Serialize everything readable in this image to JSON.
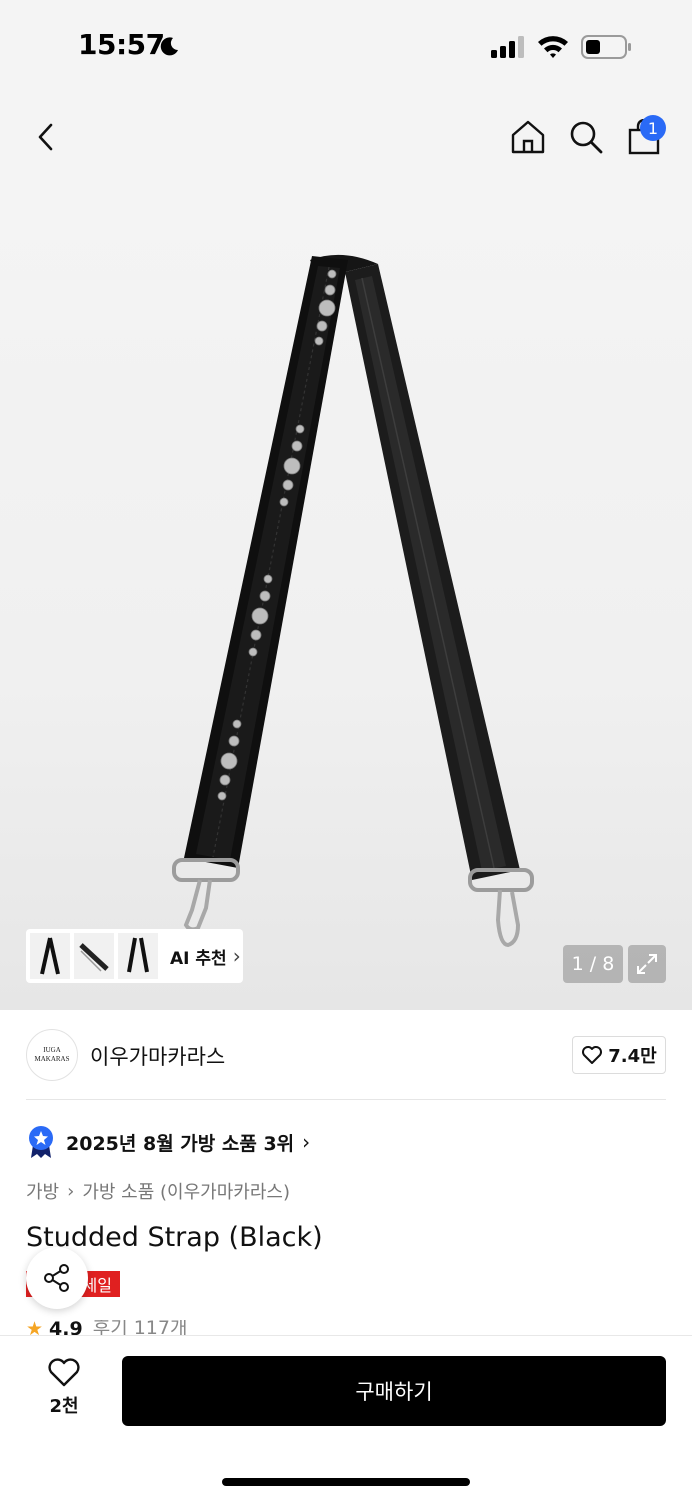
{
  "status_bar": {
    "time": "15:57"
  },
  "nav": {
    "cart_count": "1"
  },
  "gallery": {
    "ai_label": "AI 추천",
    "page_counter": "1 / 8"
  },
  "brand": {
    "logo_line1": "IUGA",
    "logo_line2": "MAKARAS",
    "name": "이우가마카라스",
    "likes": "7.4만"
  },
  "ranking": {
    "text": "2025년 8월 가방 소품 3위"
  },
  "breadcrumb": {
    "level1": "가방",
    "level2": "가방 소품 (이우가마카라스)"
  },
  "product": {
    "title": "Studded Strap (Black)",
    "sale_badge": "세일",
    "rating": "4.9",
    "reviews": "후기 117개"
  },
  "bottom_bar": {
    "wish_count": "2천",
    "buy_label": "구매하기"
  },
  "colors": {
    "accent_blue": "#2a6af6",
    "sale_red": "#e02020",
    "star": "#f5a524",
    "buy_button": "#000000"
  },
  "icons": [
    "moon-icon",
    "signal-icon",
    "wifi-icon",
    "battery-icon",
    "back-icon",
    "home-icon",
    "search-icon",
    "bag-icon",
    "expand-icon",
    "heart-icon",
    "rank-badge-icon",
    "share-icon",
    "star-icon",
    "chevron-right-icon"
  ]
}
